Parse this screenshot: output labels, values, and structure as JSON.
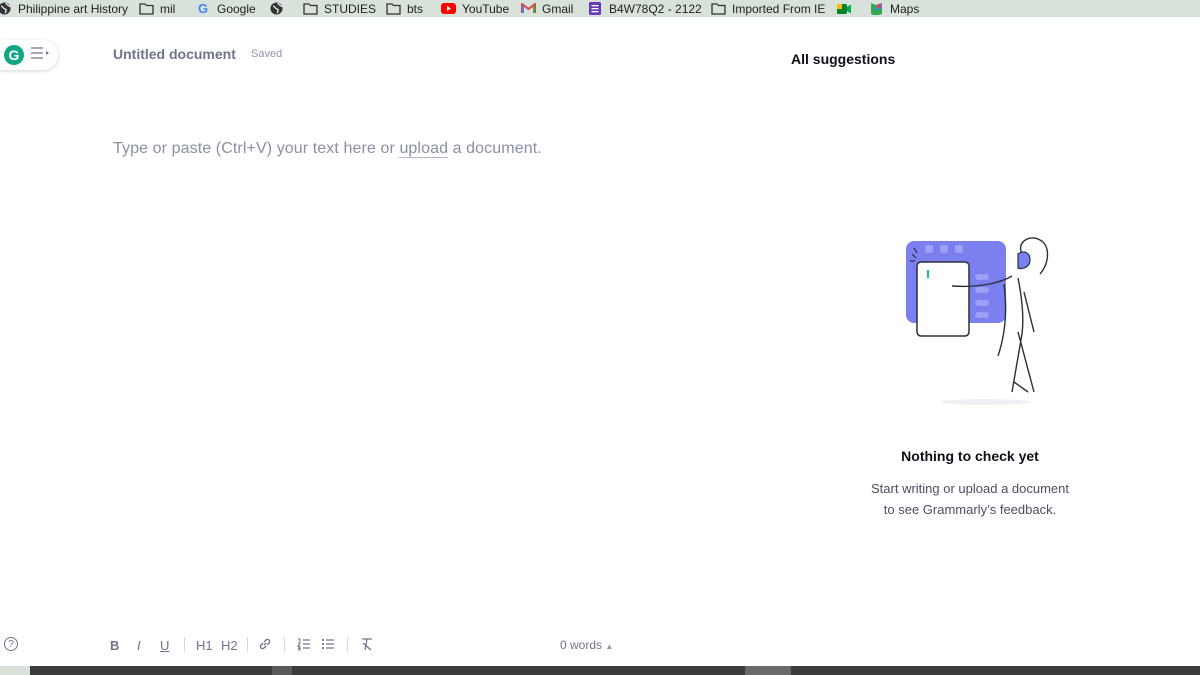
{
  "bookmarks": [
    {
      "label": "Philippine art History",
      "icon": "globe-icon"
    },
    {
      "label": "mil",
      "icon": "folder-icon"
    },
    {
      "label": "Google",
      "icon": "google-icon"
    },
    {
      "label": "",
      "icon": "globe-icon"
    },
    {
      "label": "STUDIES",
      "icon": "folder-icon"
    },
    {
      "label": "bts",
      "icon": "folder-icon"
    },
    {
      "label": "YouTube",
      "icon": "youtube-icon"
    },
    {
      "label": "Gmail",
      "icon": "gmail-icon"
    },
    {
      "label": "B4W78Q2 - 2122",
      "icon": "forms-icon"
    },
    {
      "label": "Imported From IE",
      "icon": "folder-icon"
    },
    {
      "label": "",
      "icon": "meet-icon"
    },
    {
      "label": "Maps",
      "icon": "maps-icon"
    }
  ],
  "editor": {
    "logo_letter": "G",
    "title": "Untitled document",
    "status": "Saved",
    "placeholder_pre": "Type or paste (Ctrl+V) your text here or ",
    "placeholder_link": "upload",
    "placeholder_post": " a document."
  },
  "panel": {
    "header": "All suggestions",
    "empty_title": "Nothing to check yet",
    "empty_line1": "Start writing or upload a document",
    "empty_line2": "to see Grammarly’s feedback."
  },
  "toolbar": {
    "help": "?",
    "bold": "B",
    "italic": "I",
    "underline": "U",
    "h1": "H1",
    "h2": "H2",
    "word_count": "0 words"
  },
  "colors": {
    "bookmarks_bg": "#d8e2da",
    "grammarly_green": "#11a683",
    "illustration_purple": "#7b7ff0"
  }
}
